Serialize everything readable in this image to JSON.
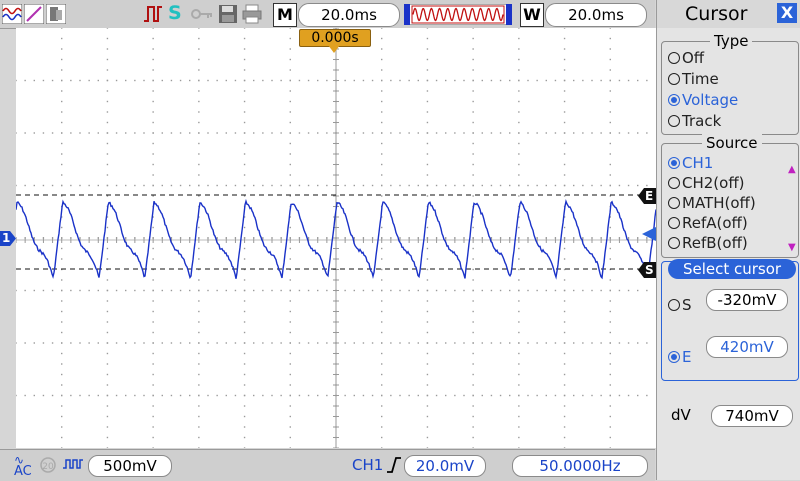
{
  "top_bar": {
    "trigger_status": "S",
    "timebase_label": "M",
    "timebase_value": "20.0ms",
    "window_label": "W",
    "window_value": "20.0ms",
    "trigger_position": "0.000s"
  },
  "bottom_bar": {
    "coupling": "AC",
    "ch1_scale": "500mV",
    "trigger_source": "CH1",
    "trigger_level": "20.0mV",
    "frequency": "50.0000Hz"
  },
  "plot": {
    "channel_marker": "1",
    "cursor_e_label": "E",
    "cursor_s_label": "S",
    "trace_color": "#1a32c8",
    "signal_frequency_hz": 50,
    "timebase_ms_per_div": 20,
    "volts_per_div": 0.5,
    "cursor_s_mv": -320,
    "cursor_e_mv": 420
  },
  "panel": {
    "title": "Cursor",
    "close_glyph": "X",
    "type_group": {
      "title": "Type",
      "options": [
        "Off",
        "Time",
        "Voltage",
        "Track"
      ],
      "selected": "Voltage"
    },
    "source_group": {
      "title": "Source",
      "options": [
        "CH1",
        "CH2(off)",
        "MATH(off)",
        "RefA(off)",
        "RefB(off)"
      ],
      "selected": "CH1"
    },
    "select_cursor": {
      "title": "Select cursor",
      "s_label": "S",
      "s_value": "-320mV",
      "e_label": "E",
      "e_value": "420mV"
    },
    "dv_label": "dV",
    "dv_value": "740mV"
  },
  "colors": {
    "accent": "#2b63d8",
    "trace": "#1a32c8",
    "trigger_tag": "#e0a020"
  }
}
